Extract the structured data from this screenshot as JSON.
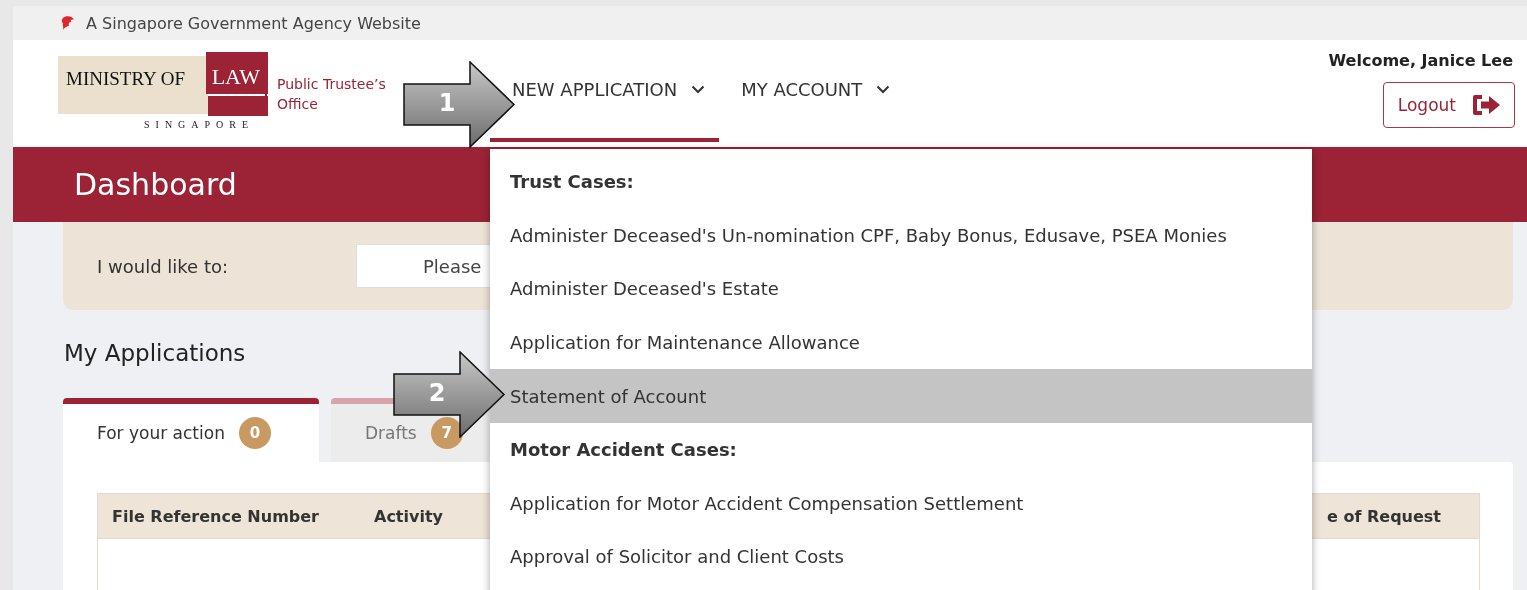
{
  "gov_banner": {
    "text": "A Singapore Government Agency Website"
  },
  "logo": {
    "ministry": "MINISTRY OF",
    "law": "LAW",
    "country": "SINGAPORE",
    "office": "Public Trustee’s Office"
  },
  "nav": [
    {
      "label": "NEW APPLICATION",
      "selected": true
    },
    {
      "label": "MY ACCOUNT",
      "selected": false
    }
  ],
  "user": {
    "welcome": "Welcome, Janice Lee",
    "logout": "Logout"
  },
  "page_title": "Dashboard",
  "action_panel": {
    "label": "I would like to:",
    "select_value": "Please"
  },
  "section_title": "My Applications",
  "tabs": [
    {
      "label": "For your action",
      "count": "0",
      "selected": true
    },
    {
      "label": "Drafts",
      "count": "7",
      "selected": false
    }
  ],
  "table": {
    "columns": [
      "File Reference Number",
      "Activity",
      "e of Request"
    ]
  },
  "dropdown": {
    "items": [
      {
        "kind": "group",
        "label": "Trust Cases:"
      },
      {
        "kind": "option",
        "label": "Administer Deceased's Un-nomination CPF, Baby Bonus, Edusave, PSEA Monies",
        "selected": false
      },
      {
        "kind": "option",
        "label": "Administer Deceased's Estate",
        "selected": false
      },
      {
        "kind": "option",
        "label": "Application for Maintenance Allowance",
        "selected": false
      },
      {
        "kind": "option",
        "label": "Statement of Account",
        "selected": true
      },
      {
        "kind": "group",
        "label": "Motor Accident Cases:"
      },
      {
        "kind": "option",
        "label": "Application for Motor Accident Compensation Settlement",
        "selected": false
      },
      {
        "kind": "option",
        "label": "Approval of Solicitor and Client Costs",
        "selected": false
      }
    ]
  },
  "annotations": [
    {
      "number": "1"
    },
    {
      "number": "2"
    }
  ]
}
